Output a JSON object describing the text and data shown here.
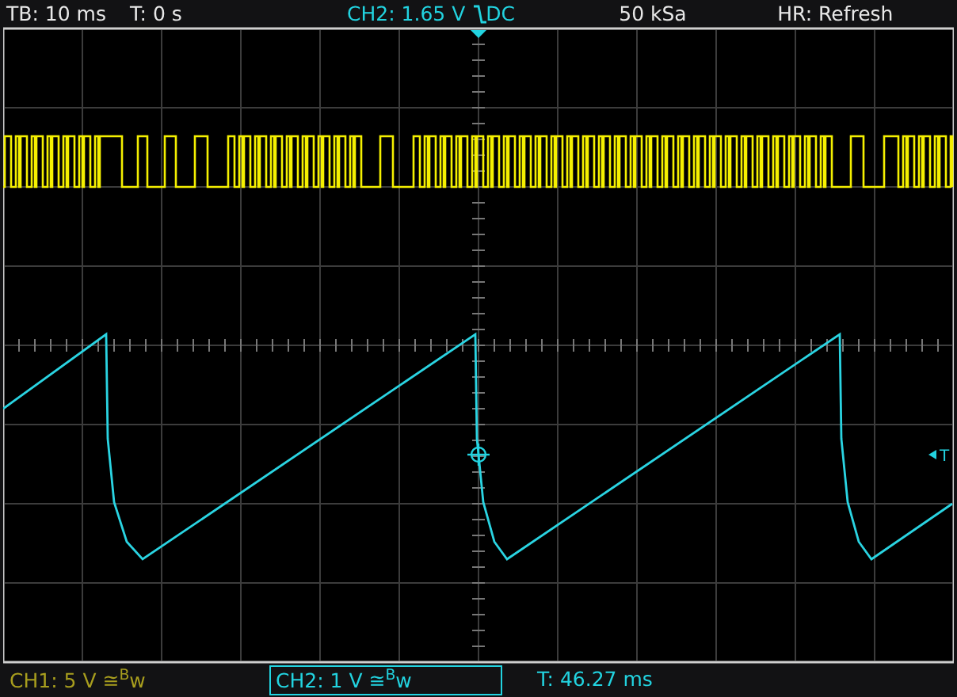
{
  "status_bar": {
    "timebase": "TB: 10 ms",
    "trigger_time": "T: 0 s",
    "trigger_source": "CH2: 1.65 V",
    "trigger_coupling": "DC",
    "sample_rate": "50 kSa",
    "acquisition_mode": "HR: Refresh"
  },
  "trigger_marker": {
    "label": "T"
  },
  "channels": [
    {
      "label": "CH1: 5 V ≅$^{B}$w",
      "color": "#a89e1e",
      "selected": false
    },
    {
      "label": "CH2: 1 V ≅$^{B}$w",
      "color": "#22d3e0",
      "selected": true
    }
  ],
  "cursor_readout": "T: 46.27 ms"
}
